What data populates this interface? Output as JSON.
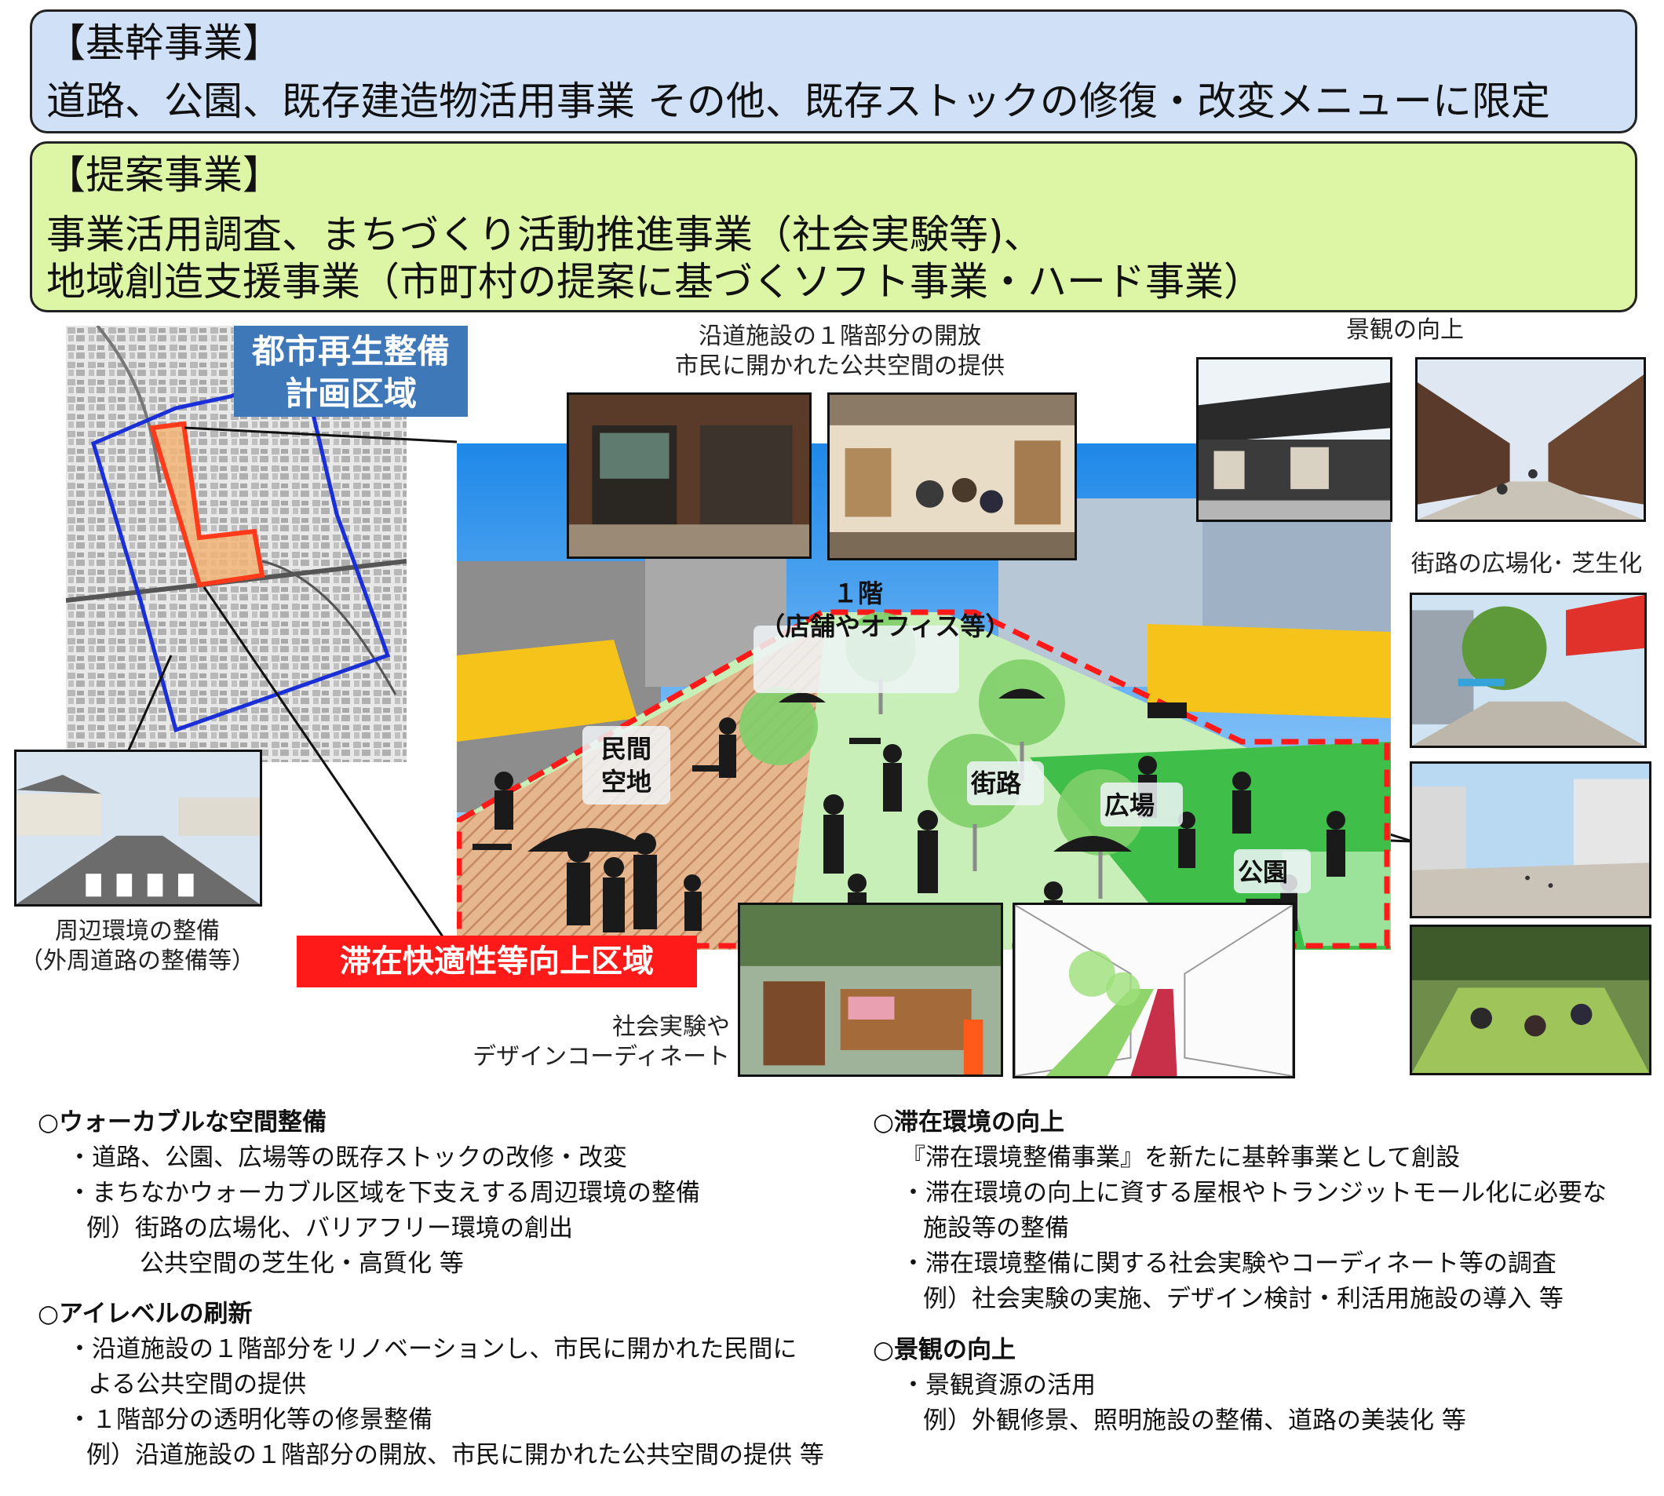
{
  "core": {
    "title": "【基幹事業】",
    "line1": "道路、公園、既存建造物活用事業 その他、既存ストックの修復・改変メニューに限定",
    "bg": "#cfe0f7"
  },
  "proposal": {
    "title": "【提案事業】",
    "line1": "事業活用調査、まちづくり活動推進事業（社会実験等)、",
    "line2": "地域創造支援事業（市町村の提案に基づくソフト事業・ハード事業）",
    "bg": "#dcf6a6"
  },
  "map_label": {
    "line1": "都市再生整備",
    "line2": "計画区域"
  },
  "zone_label": "滞在快適性等向上区域",
  "captions": {
    "ground_open_1": "沿道施設の１階部分の開放",
    "ground_open_2": "市民に開かれた公共空間の提供",
    "landscape": "景観の向上",
    "street_plaza": "街路の広場化･ 芝生化",
    "surround_1": "周辺環境の整備",
    "surround_2": "（外周道路の整備等）",
    "experiment_1": "社会実験や",
    "experiment_2": "デザインコーディネート"
  },
  "illustration_labels": {
    "first_floor_1": "１階",
    "first_floor_2": "（店舗やオフィス等）",
    "private_1": "民間",
    "private_2": "空地",
    "street": "街路",
    "plaza": "広場",
    "park": "公園"
  },
  "sections_left": [
    {
      "heading": "○ウォーカブルな空間整備",
      "lines": [
        "・道路、公園、広場等の既存ストックの改修・改変",
        "・まちなかウォーカブル区域を下支えする周辺環境の整備",
        "例）街路の広場化、バリアフリー環境の創出",
        "公共空間の芝生化・高質化 等"
      ]
    },
    {
      "heading": "○アイレベルの刷新",
      "lines": [
        "・沿道施設の１階部分をリノベーションし、市民に開かれた民間に",
        "よる公共空間の提供",
        "・１階部分の透明化等の修景整備",
        "例）沿道施設の１階部分の開放、市民に開かれた公共空間の提供 等"
      ]
    }
  ],
  "sections_right": [
    {
      "heading": "○滞在環境の向上",
      "lines": [
        "『滞在環境整備事業』を新たに基幹事業として創設",
        "・滞在環境の向上に資する屋根やトランジットモール化に必要な",
        "施設等の整備",
        "・滞在環境整備に関する社会実験やコーディネート等の調査",
        "例）社会実験の実施、デザイン検討・利活用施設の導入 等"
      ]
    },
    {
      "heading": "○景観の向上",
      "lines": [
        "・景観資源の活用",
        "例）外観修景、照明施設の整備、道路の美装化 等"
      ]
    }
  ],
  "colors": {
    "zone_red": "#ff1a1a",
    "map_blue_label": "#3f78b8",
    "boundary_blue": "#1a2fd6",
    "street_green": "#c8efb8",
    "plaza_green": "#3fbf4a",
    "private_brown": "#d9a27a",
    "awning_yellow": "#f5c31a"
  }
}
